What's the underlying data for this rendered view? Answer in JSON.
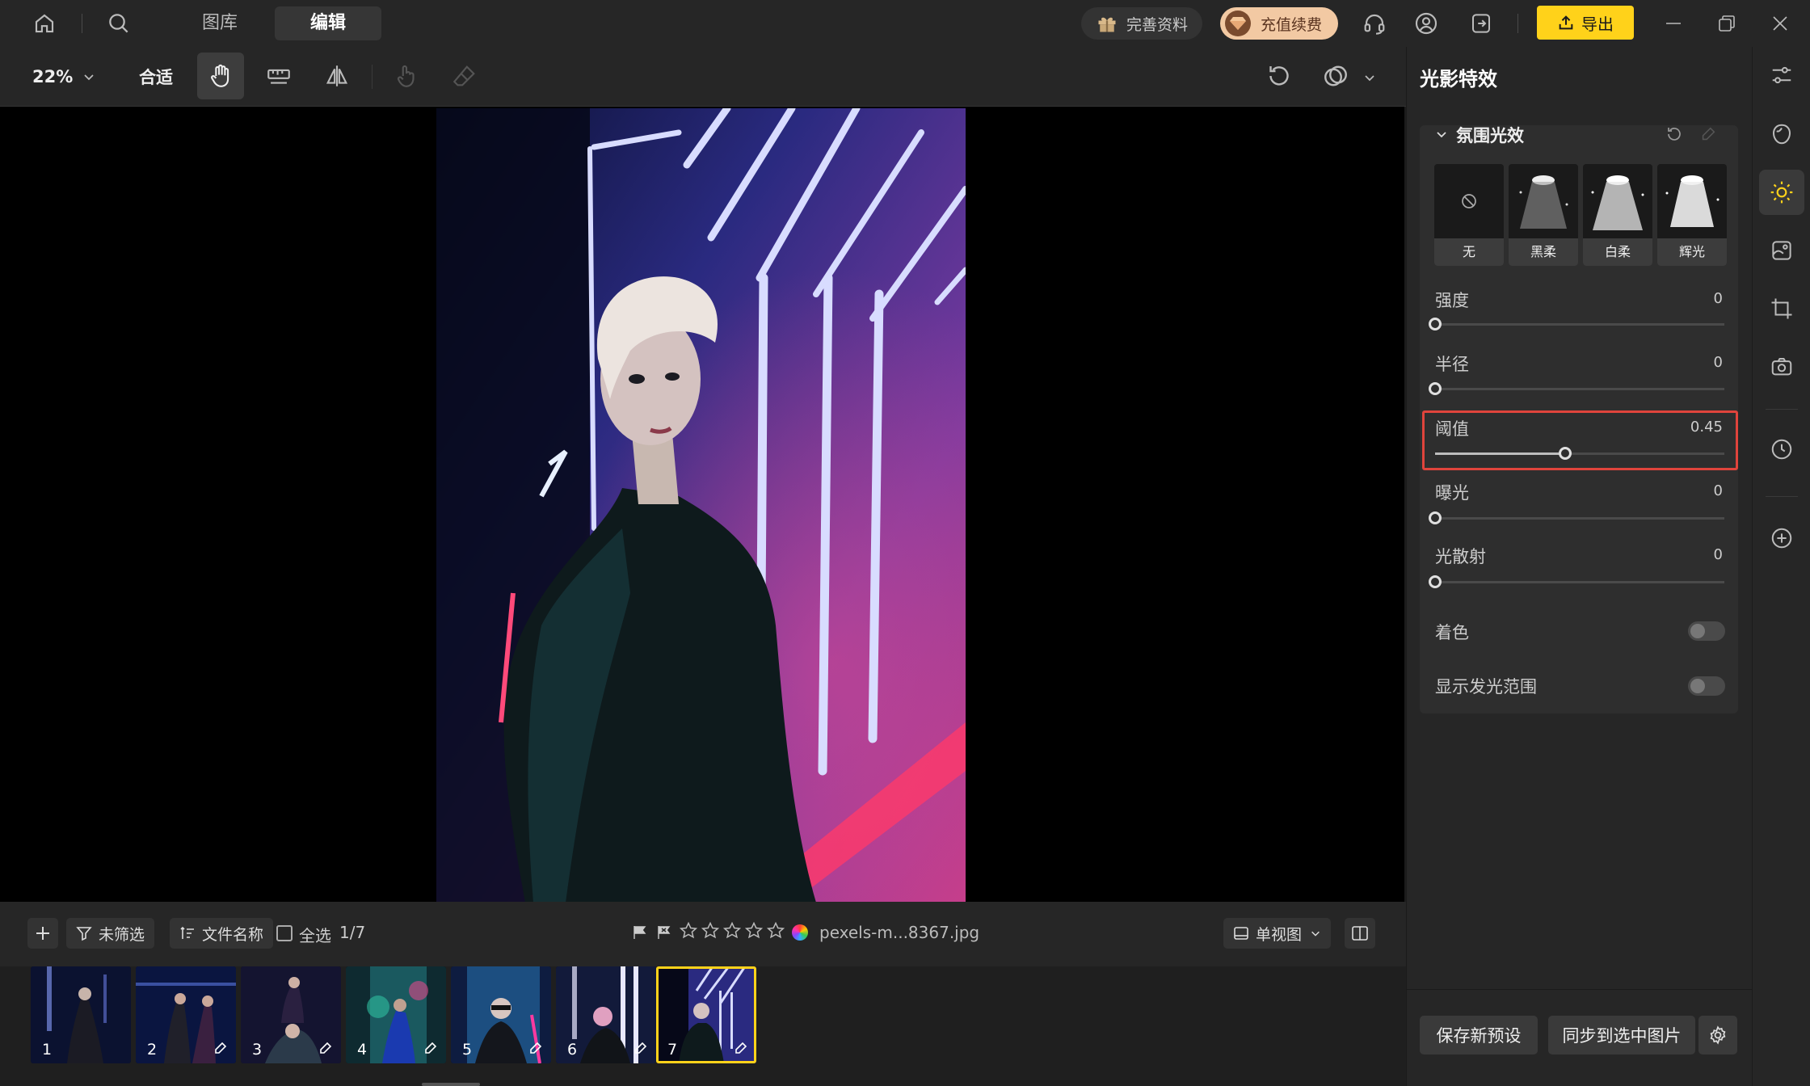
{
  "topbar": {
    "tabs": [
      {
        "label": "图库"
      },
      {
        "label": "编辑"
      }
    ],
    "complete_profile_label": "完善资料",
    "recharge_label": "充值续费",
    "export_label": "导出",
    "accent_color": "#ffd21a"
  },
  "toolbar": {
    "zoom": "22%",
    "fit_label": "合适"
  },
  "bottombar": {
    "filter_label": "未筛选",
    "sort_label": "文件名称",
    "select_all_label": "全选",
    "count": "1/7",
    "filename": "pexels-m...8367.jpg",
    "rating_stars": 5,
    "view_label": "单视图"
  },
  "filmstrip": {
    "thumbnails": [
      {
        "number": "1",
        "edited": false
      },
      {
        "number": "2",
        "edited": true
      },
      {
        "number": "3",
        "edited": true
      },
      {
        "number": "4",
        "edited": true
      },
      {
        "number": "5",
        "edited": true
      },
      {
        "number": "6",
        "edited": true
      },
      {
        "number": "7",
        "edited": true,
        "selected": true
      }
    ]
  },
  "panel": {
    "title": "光影特效",
    "section_title": "氛围光效",
    "presets": [
      {
        "label": "无",
        "icon": "none-icon"
      },
      {
        "label": "黑柔",
        "icon": "spotlight-icon"
      },
      {
        "label": "白柔",
        "icon": "spotlight-icon"
      },
      {
        "label": "辉光",
        "icon": "spotlight-icon"
      }
    ],
    "sliders": [
      {
        "label": "强度",
        "value": "0",
        "fraction": 0
      },
      {
        "label": "半径",
        "value": "0",
        "fraction": 0
      },
      {
        "label": "阈值",
        "value": "0.45",
        "fraction": 0.45,
        "highlighted": true
      },
      {
        "label": "曝光",
        "value": "0",
        "fraction": 0
      },
      {
        "label": "光散射",
        "value": "0",
        "fraction": 0
      }
    ],
    "toggles": [
      {
        "label": "着色",
        "on": false
      },
      {
        "label": "显示发光范围",
        "on": false
      }
    ],
    "save_preset_label": "保存新预设",
    "sync_label": "同步到选中图片",
    "highlight_color": "#e0443c"
  }
}
